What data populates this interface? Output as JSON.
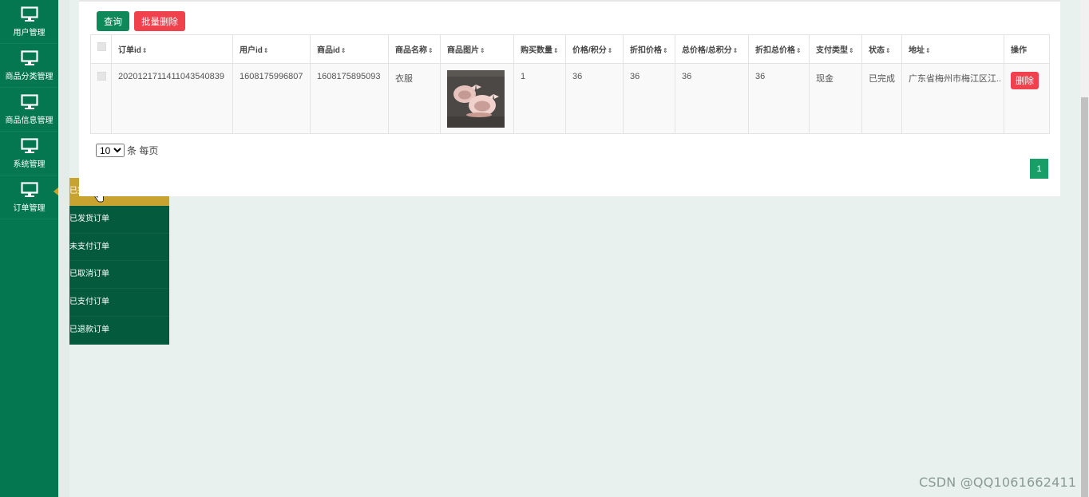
{
  "sidebar": {
    "items": [
      {
        "label": "用户管理",
        "icon": "monitor-icon"
      },
      {
        "label": "商品分类管理",
        "icon": "monitor-icon"
      },
      {
        "label": "商品信息管理",
        "icon": "monitor-icon"
      },
      {
        "label": "系统管理",
        "icon": "monitor-icon"
      },
      {
        "label": "订单管理",
        "icon": "monitor-icon"
      }
    ]
  },
  "submenu": {
    "items": [
      {
        "label": "已完成订单",
        "active": true
      },
      {
        "label": "已发货订单"
      },
      {
        "label": "未支付订单"
      },
      {
        "label": "已取消订单"
      },
      {
        "label": "已支付订单"
      },
      {
        "label": "已退款订单"
      }
    ]
  },
  "toolbar": {
    "query_label": "查询",
    "batch_delete_label": "批量删除"
  },
  "table": {
    "columns": [
      "订单id",
      "用户id",
      "商品id",
      "商品名称",
      "商品图片",
      "购买数量",
      "价格/积分",
      "折扣价格",
      "总价格/总积分",
      "折扣总价格",
      "支付类型",
      "状态",
      "地址",
      "操作"
    ],
    "sort_icon": "⇕",
    "rows": [
      {
        "order_id": "20201217114110435408​39",
        "user_id": "1608175996807",
        "product_id": "1608175895093",
        "product_name": "衣服",
        "quantity": "1",
        "price": "36",
        "discount_price": "36",
        "total_price": "36",
        "discount_total": "36",
        "pay_type": "现金",
        "status": "已完成",
        "address": "广东省梅州市梅江区江..",
        "delete_label": "删除"
      }
    ]
  },
  "pagination": {
    "page_size": "10",
    "per_page_label": "条 每页",
    "current_page": "1"
  },
  "watermark": "CSDN @QQ1061662411",
  "colors": {
    "sidebar": "#047751",
    "submenu": "#045a3d",
    "active": "#c9a32f",
    "primary": "#10895a",
    "danger": "#f0424d"
  }
}
